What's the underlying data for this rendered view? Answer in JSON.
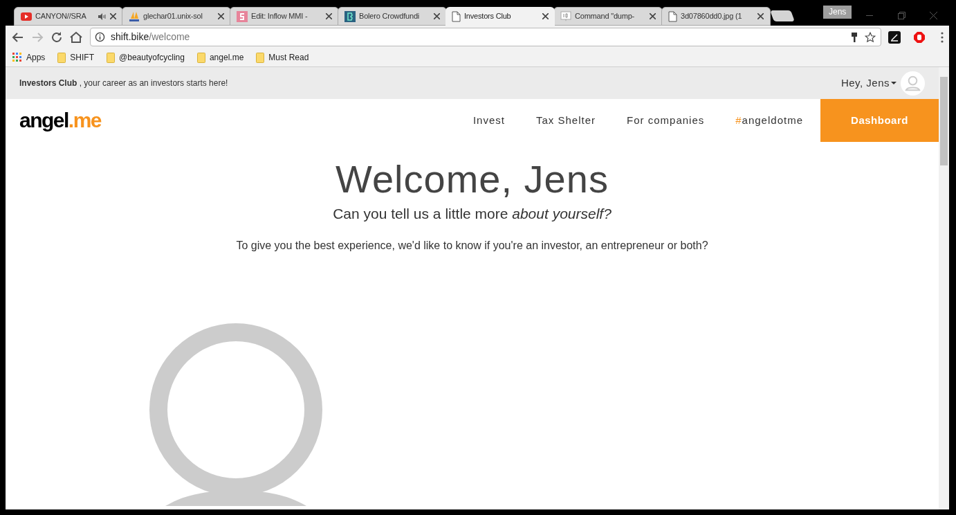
{
  "tabs": [
    {
      "title": "CANYON//SRA",
      "kind": "video",
      "audio": true,
      "selected": false
    },
    {
      "title": "glechar01.unix-sol",
      "kind": "pma",
      "audio": false,
      "selected": false
    },
    {
      "title": "Edit: Inflow MMI -",
      "kind": "s",
      "audio": false,
      "selected": false
    },
    {
      "title": "Bolero Crowdfundi",
      "kind": "b",
      "audio": false,
      "selected": false
    },
    {
      "title": "Investors Club",
      "kind": "page",
      "audio": false,
      "selected": true
    },
    {
      "title": "Command \"dump-",
      "kind": "io",
      "audio": false,
      "selected": false
    },
    {
      "title": "3d07860dd0.jpg (1",
      "kind": "page",
      "audio": false,
      "selected": false
    }
  ],
  "profile": "Jens",
  "address": {
    "host": "shift.bike",
    "path": "/welcome"
  },
  "bookmarks": [
    {
      "label": "Apps",
      "kind": "apps"
    },
    {
      "label": "SHIFT",
      "kind": "folder"
    },
    {
      "label": "@beautyofcycling",
      "kind": "folder"
    },
    {
      "label": "angel.me",
      "kind": "folder"
    },
    {
      "label": "Must Read",
      "kind": "folder"
    }
  ],
  "topbar": {
    "tagline": "**Investors Club** , your career as an investors starts here!",
    "greeting": "Hey, Jens"
  },
  "logo": {
    "main": "angel",
    "accent": ".me"
  },
  "nav": [
    {
      "label": "Invest"
    },
    {
      "label": "Tax Shelter"
    },
    {
      "label": "For companies"
    },
    {
      "prefix": "#",
      "label": "angeldotme"
    }
  ],
  "cta": "Dashboard",
  "welcome": {
    "title": "Welcome, Jens",
    "subtitle": "Can you tell us a little more *about yourself?*",
    "question": "To give you the best experience, we'd like to know if you're an investor, an entrepreneur or both?"
  }
}
